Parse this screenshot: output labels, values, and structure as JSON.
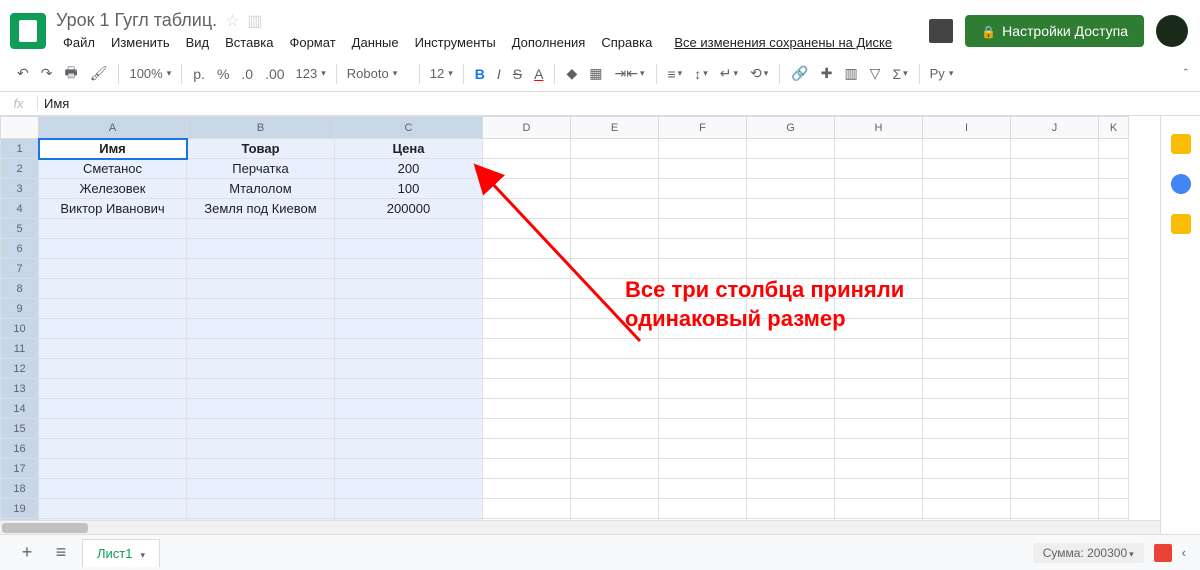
{
  "doc": {
    "title": "Урок 1 Гугл таблиц."
  },
  "menu": {
    "file": "Файл",
    "edit": "Изменить",
    "view": "Вид",
    "insert": "Вставка",
    "format": "Формат",
    "data": "Данные",
    "tools": "Инструменты",
    "addons": "Дополнения",
    "help": "Справка",
    "saved": "Все изменения сохранены на Диске"
  },
  "share": {
    "label": "Настройки Доступа"
  },
  "toolbar": {
    "zoom": "100%",
    "currency": "р.",
    "percent": "%",
    "dec_dec": ".0",
    "dec_inc": ".00",
    "numfmt": "123",
    "font": "Roboto",
    "size": "12",
    "more": "…",
    "lang": "Ру"
  },
  "formula": {
    "fx": "fx",
    "value": "Имя"
  },
  "columns": [
    "A",
    "B",
    "C",
    "D",
    "E",
    "F",
    "G",
    "H",
    "I",
    "J",
    "K"
  ],
  "headers": {
    "name": "Имя",
    "item": "Товар",
    "price": "Цена"
  },
  "rows": [
    {
      "name": "Сметанос",
      "item": "Перчатка",
      "price": "200"
    },
    {
      "name": "Железовек",
      "item": "Мталолом",
      "price": "100"
    },
    {
      "name": "Виктор Иванович",
      "item": "Земля под Киевом",
      "price": "200000"
    }
  ],
  "annotation": {
    "line1": "Все три столбца приняли",
    "line2": "одинаковый размер"
  },
  "bottom": {
    "sheet1": "Лист1",
    "sum": "Сумма: 200300"
  }
}
